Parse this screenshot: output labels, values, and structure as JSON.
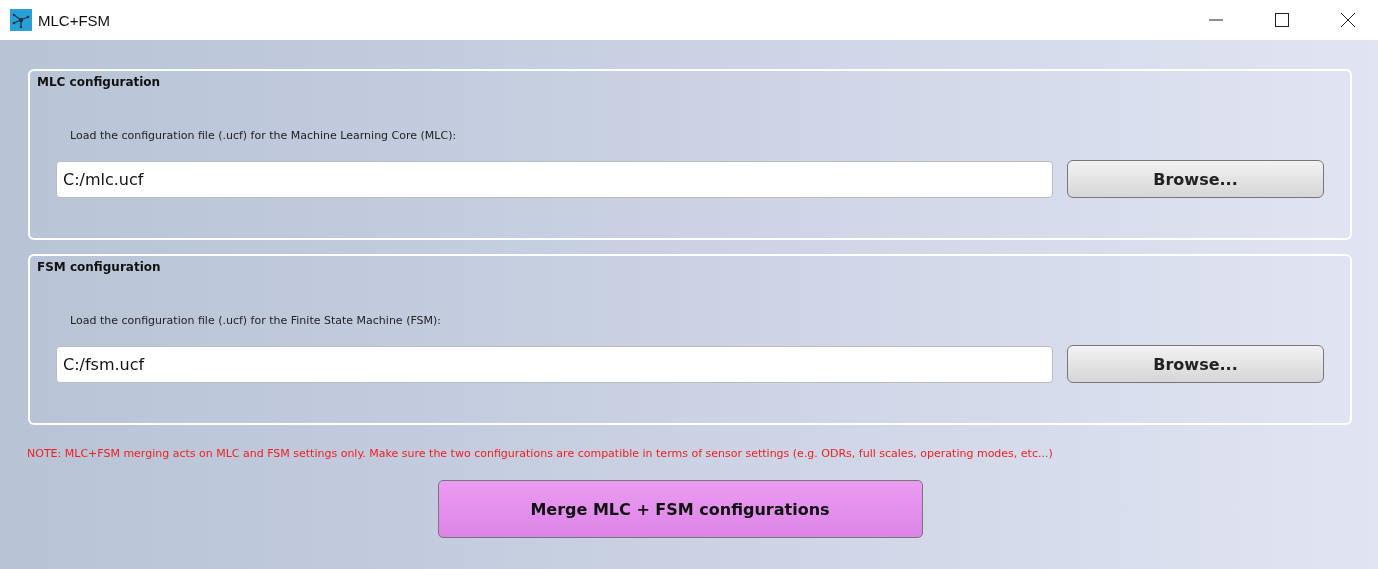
{
  "window": {
    "title": "MLC+FSM"
  },
  "groups": [
    {
      "title": "MLC configuration",
      "description": "Load the configuration file (.ucf) for the Machine Learning Core (MLC):",
      "path": "C:/mlc.ucf",
      "button": "Browse..."
    },
    {
      "title": "FSM configuration",
      "description": "Load the configuration file (.ucf) for the Finite State Machine (FSM):",
      "path": "C:/fsm.ucf",
      "button": "Browse..."
    }
  ],
  "note": "NOTE: MLC+FSM merging acts on MLC and FSM settings only. Make sure the two configurations are compatible in terms of sensor settings (e.g. ODRs, full scales, operating modes, etc...)",
  "merge_button": "Merge MLC + FSM configurations"
}
